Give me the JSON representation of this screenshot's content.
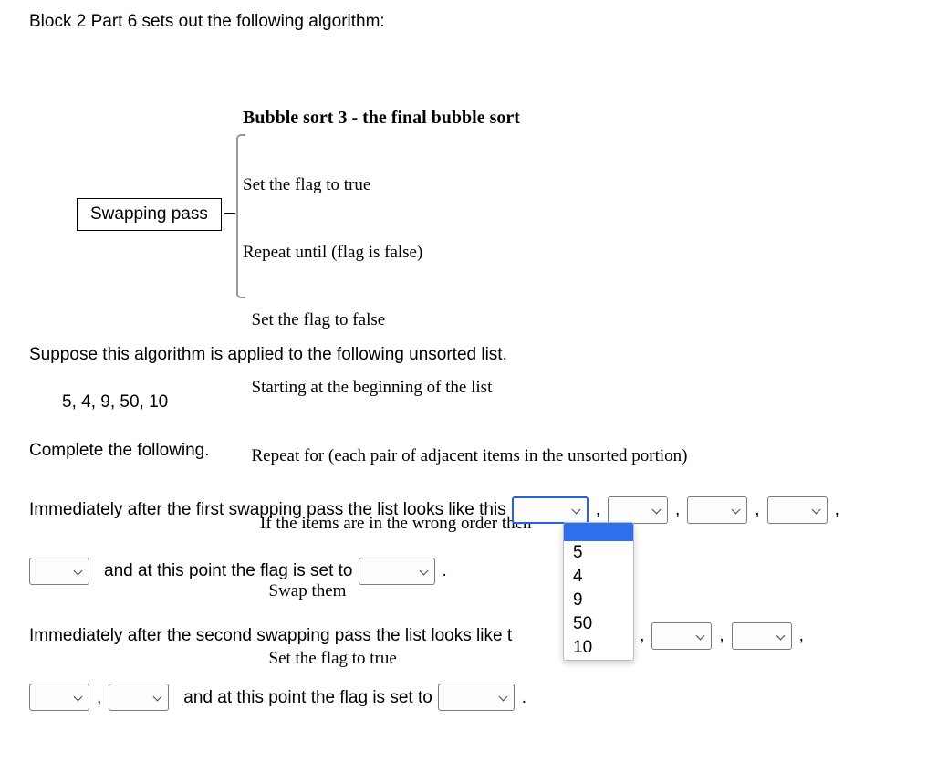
{
  "intro": "Block 2 Part 6 sets out the following algorithm:",
  "swapping_label": "Swapping pass",
  "algo": {
    "title": "Bubble sort 3 - the final bubble sort",
    "l1": "Set the flag to true",
    "l2": "Repeat until (flag is false)",
    "l3": "  Set the flag to false",
    "l4": "  Starting at the beginning of the list",
    "l5": "  Repeat for (each pair of adjacent items in the unsorted portion)",
    "l6": "    If the items are in the wrong order then",
    "l7": "      Swap them",
    "l8": "      Set the flag to true"
  },
  "suppose": "Suppose this algorithm is applied to the following unsorted list.",
  "unsorted_list": "5, 4, 9, 50, 10",
  "complete": "Complete the following.",
  "q1_a": "Immediately after the first swapping pass the list looks like this",
  "q1_b": "and at this point the flag is set to",
  "q2_a": "Immediately after the second swapping pass the list looks like t",
  "q2_b": "and at this point the flag is set to",
  "comma": ",",
  "period": ".",
  "dropdown_options": [
    "5",
    "4",
    "9",
    "50",
    "10"
  ]
}
